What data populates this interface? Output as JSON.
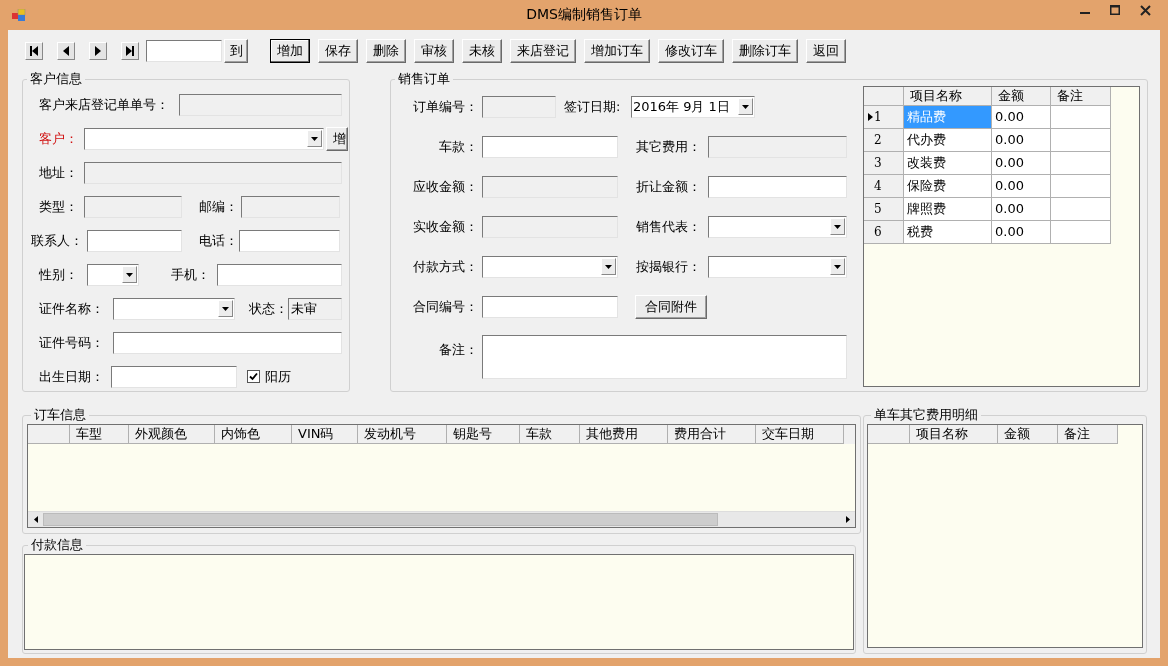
{
  "window": {
    "title": "DMS编制销售订单"
  },
  "navigator": {
    "goto_button": "到"
  },
  "toolbar": [
    {
      "label": "增加",
      "default": true
    },
    {
      "label": "保存",
      "default": false
    },
    {
      "label": "删除",
      "default": false
    },
    {
      "label": "审核",
      "default": false
    },
    {
      "label": "未核",
      "default": false
    },
    {
      "label": "来店登记",
      "default": false
    },
    {
      "label": "增加订车",
      "default": false
    },
    {
      "label": "修改订车",
      "default": false
    },
    {
      "label": "删除订车",
      "default": false
    },
    {
      "label": "返回",
      "default": false
    }
  ],
  "customer_info": {
    "title": "客户信息",
    "rows": [
      [
        {
          "kind": "text",
          "label": "客户来店登记单单号：",
          "readonly": true,
          "required": false
        }
      ],
      [
        {
          "kind": "combo",
          "label": "客户：",
          "readonly": false,
          "required": true
        },
        {
          "kind": "button",
          "label": "增"
        }
      ],
      [
        {
          "kind": "text",
          "label": "地址：",
          "readonly": true,
          "required": false
        }
      ],
      [
        {
          "kind": "text",
          "label": "类型：",
          "readonly": true,
          "required": false
        },
        {
          "kind": "text",
          "label": "邮编：",
          "readonly": true,
          "required": false
        }
      ],
      [
        {
          "kind": "text",
          "label": "联系人：",
          "readonly": false,
          "required": false
        },
        {
          "kind": "text",
          "label": "电话：",
          "readonly": false,
          "required": false
        }
      ],
      [
        {
          "kind": "combo",
          "label": "性别：",
          "readonly": false,
          "required": false
        },
        {
          "kind": "text",
          "label": "手机：",
          "readonly": false,
          "required": false
        }
      ],
      [
        {
          "kind": "combo",
          "label": "证件名称：",
          "readonly": false,
          "required": false
        },
        {
          "kind": "text",
          "label": "状态：",
          "readonly": true,
          "required": false,
          "value": "未审"
        }
      ],
      [
        {
          "kind": "text",
          "label": "证件号码：",
          "readonly": false,
          "required": false
        }
      ],
      [
        {
          "kind": "text",
          "label": "出生日期：",
          "readonly": false,
          "required": false
        },
        {
          "kind": "checkbox",
          "label": "阳历",
          "checked": true
        }
      ]
    ]
  },
  "sales_order": {
    "title": "销售订单",
    "rows": [
      [
        {
          "kind": "text",
          "label": "订单编号：",
          "readonly": true
        },
        {
          "kind": "date",
          "label": "签订日期:",
          "readonly": false,
          "value": "2016年 9月 1日"
        }
      ],
      [
        {
          "kind": "text",
          "label": "车款：",
          "readonly": false
        },
        {
          "kind": "text",
          "label": "其它费用：",
          "readonly": true
        }
      ],
      [
        {
          "kind": "text",
          "label": "应收金额：",
          "readonly": true
        },
        {
          "kind": "text",
          "label": "折让金额：",
          "readonly": false
        }
      ],
      [
        {
          "kind": "text",
          "label": "实收金额：",
          "readonly": true
        },
        {
          "kind": "combo",
          "label": "销售代表：",
          "readonly": false
        }
      ],
      [
        {
          "kind": "combo",
          "label": "付款方式：",
          "readonly": false
        },
        {
          "kind": "combo",
          "label": "按揭银行：",
          "readonly": false
        }
      ],
      [
        {
          "kind": "text",
          "label": "合同编号：",
          "readonly": false
        },
        {
          "kind": "button",
          "label": "合同附件"
        }
      ],
      [
        {
          "kind": "textarea",
          "label": "备注：",
          "readonly": false
        }
      ]
    ],
    "fees": {
      "columns": [
        "项目名称",
        "金额",
        "备注"
      ],
      "rows": [
        {
          "number": "1",
          "name": "精品费",
          "amount": "0.00",
          "selected": true
        },
        {
          "number": "2",
          "name": "代办费",
          "amount": "0.00",
          "selected": false
        },
        {
          "number": "3",
          "name": "改装费",
          "amount": "0.00",
          "selected": false
        },
        {
          "number": "4",
          "name": "保险费",
          "amount": "0.00",
          "selected": false
        },
        {
          "number": "5",
          "name": "牌照费",
          "amount": "0.00",
          "selected": false
        },
        {
          "number": "6",
          "name": "税费",
          "amount": "0.00",
          "selected": false
        }
      ]
    }
  },
  "vehicle_orders": {
    "title": "订车信息",
    "columns": [
      "车型",
      "外观颜色",
      "内饰色",
      "VIN码",
      "发动机号",
      "钥匙号",
      "车款",
      "其他费用",
      "费用合计",
      "交车日期"
    ]
  },
  "payment_info": {
    "title": "付款信息"
  },
  "vehicle_fees": {
    "title": "单车其它费用明细",
    "columns": [
      "项目名称",
      "金额",
      "备注"
    ]
  }
}
